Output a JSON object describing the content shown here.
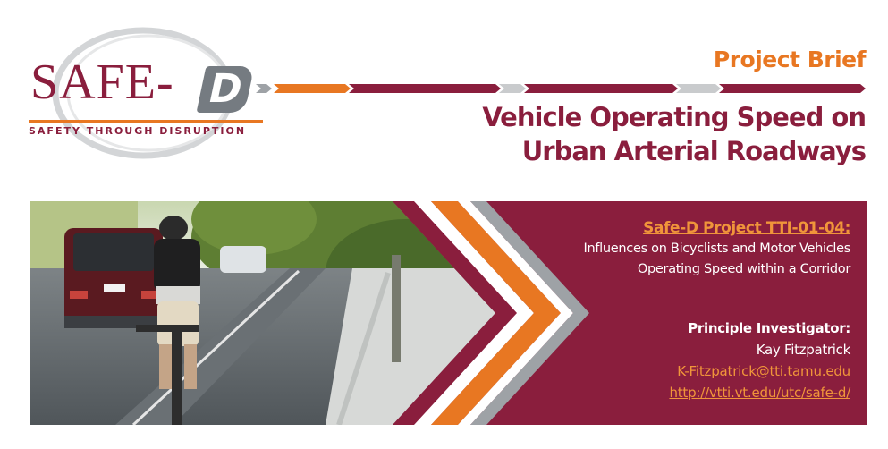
{
  "logo": {
    "word": "SAFE-",
    "letter": "D",
    "tagline": "SAFETY THROUGH DISRUPTION"
  },
  "header": {
    "eyebrow": "Project Brief",
    "title_lines": [
      "Vehicle Operating Speed on",
      "Urban Arterial Roadways"
    ]
  },
  "project": {
    "label": "Safe-D Project TTI-01-04:",
    "description_lines": [
      "Influences on Bicyclists and Motor Vehicles",
      "Operating Speed within a Corridor"
    ]
  },
  "investigator": {
    "heading": "Principle Investigator:",
    "name": "Kay Fitzpatrick",
    "email": "K-Fitzpatrick@tti.tamu.edu",
    "url": "http://vtti.vt.edu/utc/safe-d/"
  },
  "colors": {
    "maroon": "#8a1e3d",
    "orange": "#e87722",
    "gray": "#9ea2a6",
    "white": "#ffffff"
  }
}
